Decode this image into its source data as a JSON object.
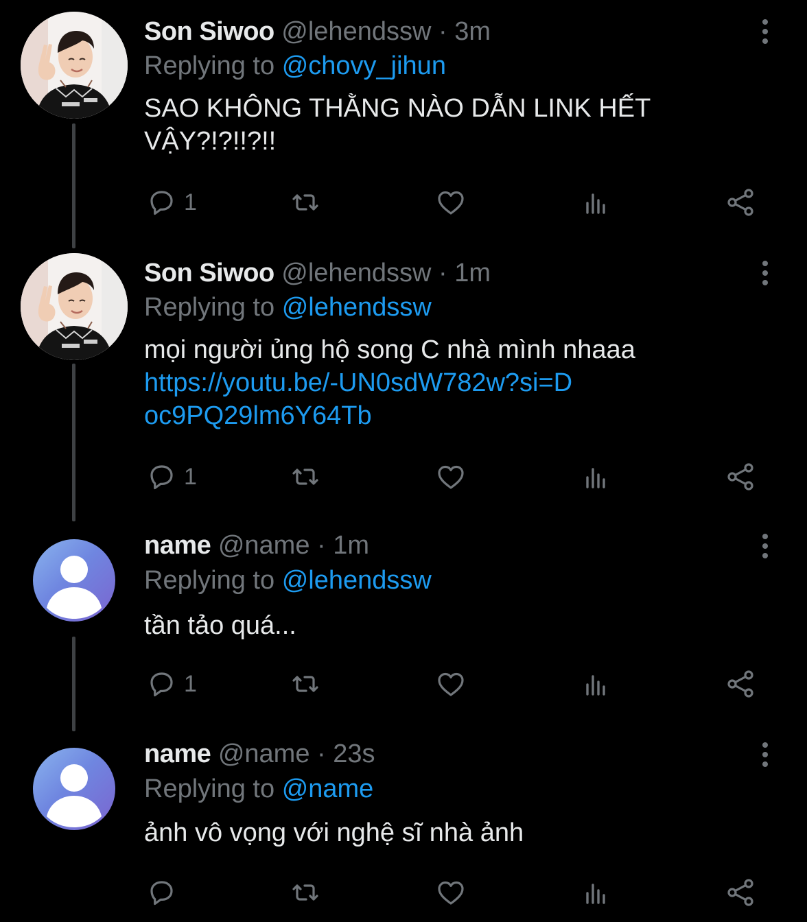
{
  "tweets": [
    {
      "display_name": "Son Siwoo",
      "handle": "@lehendssw",
      "separator": "·",
      "time": "3m",
      "replying_prefix": "Replying to",
      "replying_to": "@chovy_jihun",
      "text": "SAO KHÔNG THẰNG NÀO DẪN LINK HẾT VẬY?!?!!?!!",
      "reply_count": "1",
      "avatar": "profile-photo"
    },
    {
      "display_name": "Son Siwoo",
      "handle": "@lehendssw",
      "separator": "·",
      "time": "1m",
      "replying_prefix": "Replying to",
      "replying_to": "@lehendssw",
      "text": "mọi người ủng hộ song C nhà mình nhaaa",
      "link": "https://youtu.be/-UN0sdW782w?si=Doc9PQ29lm6Y64Tb",
      "reply_count": "1",
      "avatar": "profile-photo"
    },
    {
      "display_name": "name",
      "handle": "@name",
      "separator": "·",
      "time": "1m",
      "replying_prefix": "Replying to",
      "replying_to": "@lehendssw",
      "text": "tần tảo quá...",
      "reply_count": "1",
      "avatar": "default-user-icon"
    },
    {
      "display_name": "name",
      "handle": "@name",
      "separator": "·",
      "time": "23s",
      "replying_prefix": "Replying to",
      "replying_to": "@name",
      "text": "ảnh vô vọng với nghệ sĩ nhà ảnh",
      "reply_count": "",
      "avatar": "default-user-icon"
    }
  ],
  "icons": {
    "reply": "speech-bubble-icon",
    "retweet": "retweet-icon",
    "like": "heart-icon",
    "views": "bar-chart-icon",
    "share": "share-icon",
    "more": "vertical-ellipsis-icon"
  },
  "colors": {
    "background": "#000000",
    "text": "#e7e9ea",
    "secondary": "#71767b",
    "link": "#1d9bf0",
    "thread_line": "#3e4144"
  }
}
